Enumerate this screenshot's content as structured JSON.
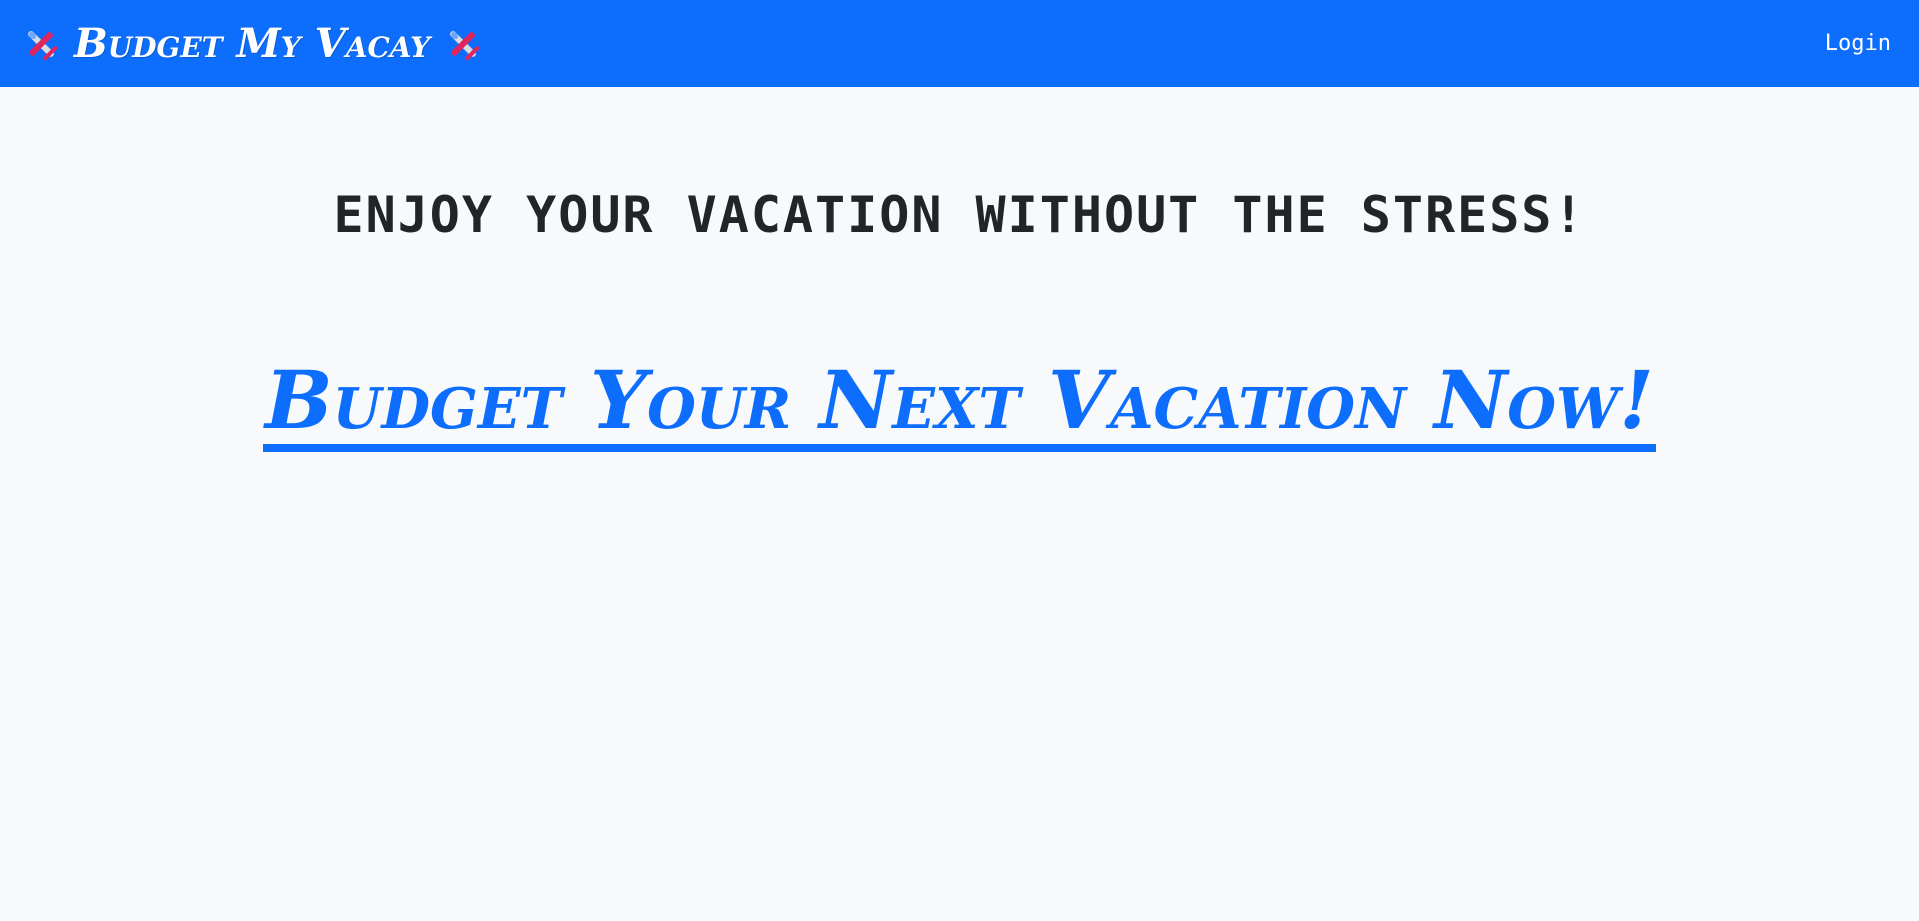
{
  "navbar": {
    "brand_label": "Budget My Vacay",
    "brand_icon": "airplane-icon",
    "login_label": "Login",
    "background_color": "#0d6efd"
  },
  "main": {
    "tagline": "ENJOY YOUR VACATION WITHOUT THE STRESS!",
    "cta_label": "Budget Your Next Vacation Now!",
    "accent_color": "#0d6efd",
    "background_color": "#f8f9fa"
  }
}
